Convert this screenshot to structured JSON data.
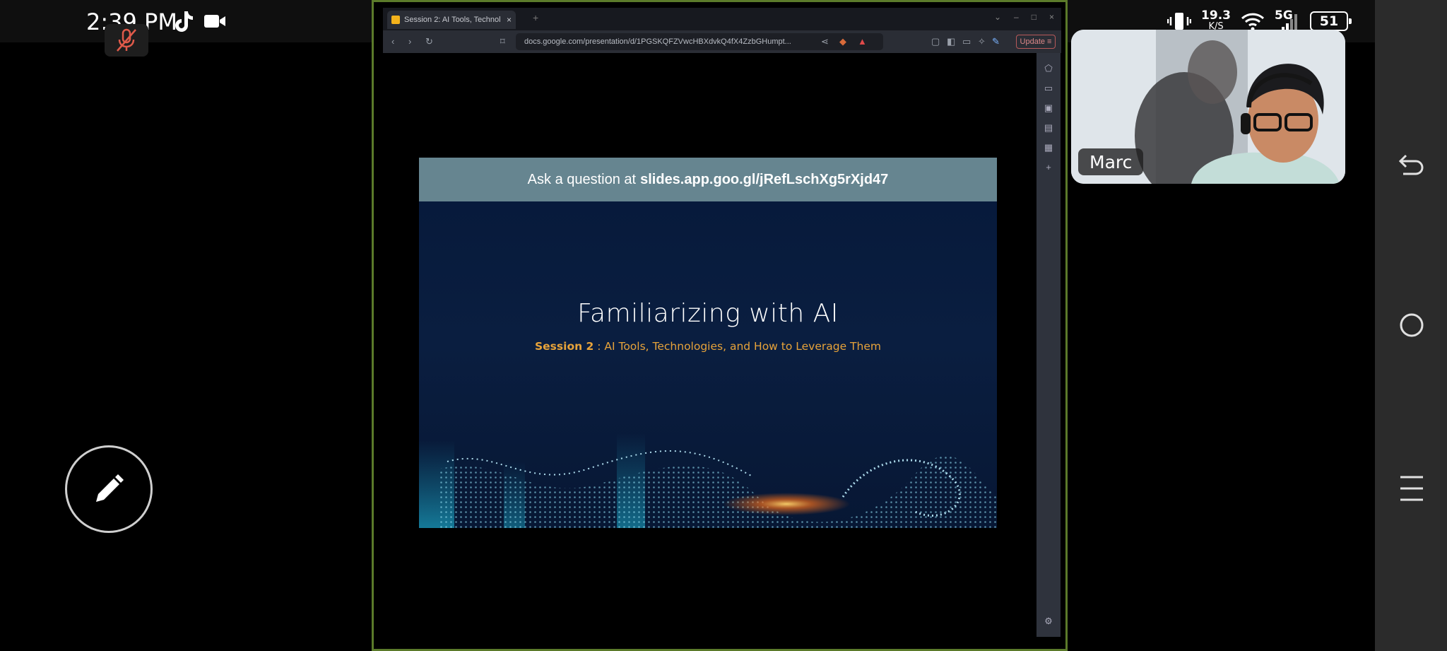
{
  "status_bar": {
    "time": "2:39 PM",
    "net_speed_value": "19.3",
    "net_speed_unit": "K/S",
    "network_type": "5G",
    "battery": "51",
    "icons": [
      "tiktok-icon",
      "video-camera-icon",
      "mic-off-icon",
      "vibrate-icon",
      "wifi-icon",
      "signal-icon",
      "battery-icon"
    ]
  },
  "browser": {
    "tab_title": "Session 2: AI Tools, Technol",
    "url": "docs.google.com/presentation/d/1PGSKQFZVwcHBXdvkQ4fX4ZzbGHumpt...",
    "update_label": "Update"
  },
  "slide": {
    "qa_prefix": "Ask a question at",
    "qa_link": "slides.app.goo.gl/jRefLschXg5rXjd47",
    "title": "Familiarizing with AI",
    "subtitle_bold": "Session 2",
    "subtitle_rest": " : AI Tools, Technologies, and How to Leverage Them"
  },
  "participant": {
    "name": "Marc"
  },
  "nav": {
    "icons": [
      "back-icon",
      "home-icon",
      "recents-icon"
    ]
  },
  "colors": {
    "frame_border": "#5b7a2a",
    "qa_banner": "#668590",
    "slide_bg": "#06193a",
    "subtitle_accent": "#e7a33a"
  }
}
